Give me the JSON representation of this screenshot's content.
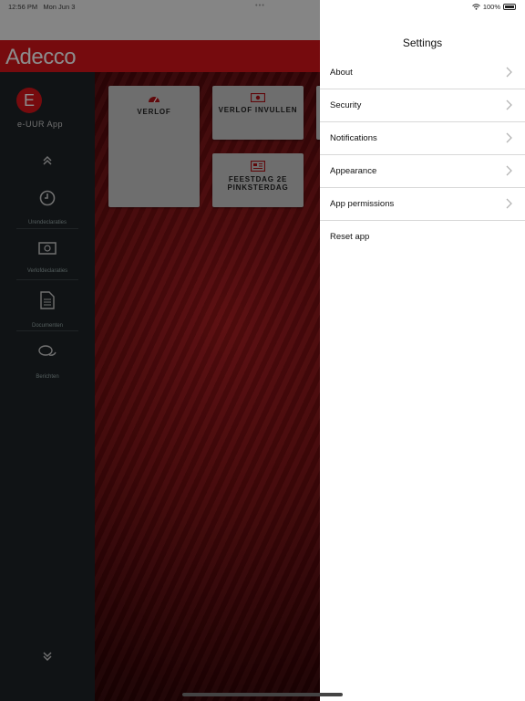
{
  "status": {
    "time": "12:56 PM",
    "date": "Mon Jun 3",
    "dots": "•••",
    "battery": "100%"
  },
  "app": {
    "brand": "Adecco",
    "logo_letter": "E",
    "title": "e-UUR App",
    "nav": [
      {
        "label": "Urendeclaraties",
        "icon": "clock-icon"
      },
      {
        "label": "Verlofdeclaraties",
        "icon": "banknote-icon"
      },
      {
        "label": "Documenten",
        "icon": "document-icon"
      },
      {
        "label": "Berichten",
        "icon": "chat-bubbles-icon"
      }
    ],
    "tiles": [
      {
        "label": "VERLOF",
        "icon": "speedometer-icon"
      },
      {
        "label": "VERLOF INVULLEN",
        "icon": "banknote-icon"
      },
      {
        "label": "FEESTDAG 2E PINKSTERDAG",
        "icon": "newspaper-icon"
      }
    ]
  },
  "settings": {
    "title": "Settings",
    "items": [
      {
        "label": "About"
      },
      {
        "label": "Security"
      },
      {
        "label": "Notifications"
      },
      {
        "label": "Appearance"
      },
      {
        "label": "App permissions"
      },
      {
        "label": "Reset app"
      }
    ]
  },
  "colors": {
    "brand_red": "#d7141a",
    "sidebar": "#1e2427",
    "panel": "#ffffff"
  }
}
